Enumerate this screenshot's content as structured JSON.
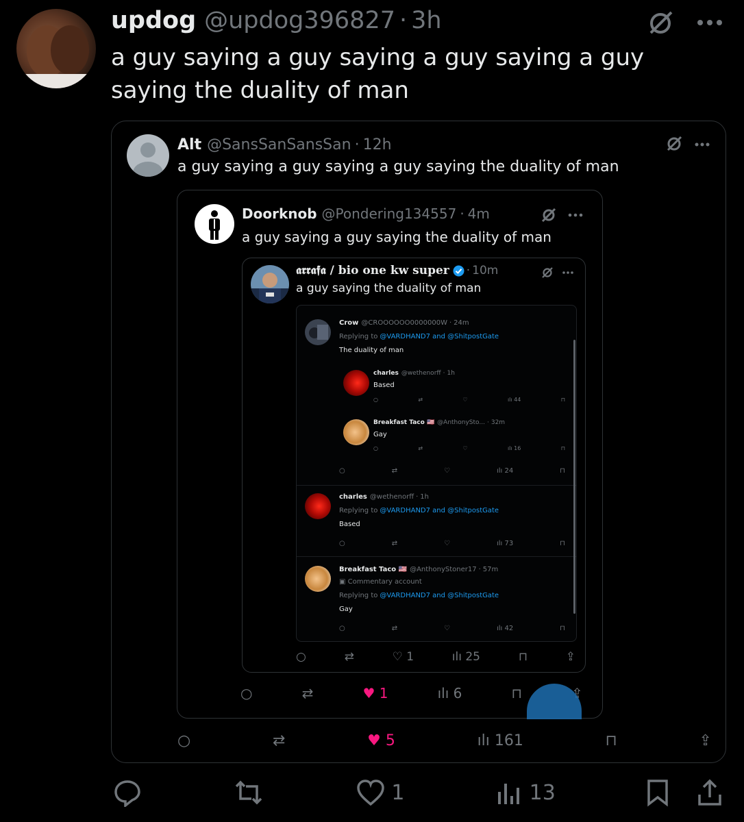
{
  "colors": {
    "bg": "#000000",
    "text": "#e7e9ea",
    "muted": "#71767b",
    "link": "#1d9bf0",
    "like": "#f91880",
    "border": "#2f3336"
  },
  "main": {
    "display_name": "updog",
    "handle": "@updog396827",
    "time": "3h",
    "text": "a guy saying a guy saying a guy saying a guy saying the duality of man",
    "counts": {
      "replies": "",
      "reposts": "",
      "likes": "1",
      "views": "13"
    }
  },
  "q1": {
    "display_name": "Alt",
    "handle": "@SansSanSansSan",
    "time": "12h",
    "text": "a guy saying a guy saying a guy saying the duality of man",
    "counts": {
      "likes": "5",
      "views": "161"
    }
  },
  "q2": {
    "display_name": "Doorknob",
    "handle": "@Pondering134557",
    "time": "4m",
    "text": "a guy saying a guy saying the duality of man",
    "counts": {
      "likes": "1",
      "views": "6"
    }
  },
  "q3": {
    "display_name": "𝖆𝖗𝖗𝖆𝖋𝖆 / bio one kw super",
    "time": "10m",
    "text": "a guy saying the duality of man",
    "counts": {
      "likes": "1",
      "views": "25"
    }
  },
  "q4": {
    "crow": {
      "name": "Crow",
      "handle": "@CROOOOOO0000000W",
      "time": "24m",
      "replying_prefix": "Replying to",
      "replying_targets": "@VARDHAND7 and @ShitpostGate",
      "text": "The duality of man",
      "views": "24"
    },
    "charles_nested": {
      "name": "charles",
      "handle": "@wethenorff",
      "time": "1h",
      "text": "Based",
      "views": "44"
    },
    "taco_nested": {
      "name": "Breakfast Taco 🇺🇸",
      "handle": "@AnthonySto...",
      "time": "32m",
      "text": "Gay",
      "views": "16"
    },
    "charles": {
      "name": "charles",
      "handle": "@wethenorff",
      "time": "1h",
      "replying_prefix": "Replying to",
      "replying_targets": "@VARDHAND7 and @ShitpostGate",
      "text": "Based",
      "views": "73"
    },
    "taco": {
      "name": "Breakfast Taco 🇺🇸",
      "handle": "@AnthonyStoner17",
      "time": "57m",
      "badge": "Commentary account",
      "replying_prefix": "Replying to",
      "replying_targets": "@VARDHAND7 and @ShitpostGate",
      "text": "Gay",
      "views": "42"
    }
  }
}
